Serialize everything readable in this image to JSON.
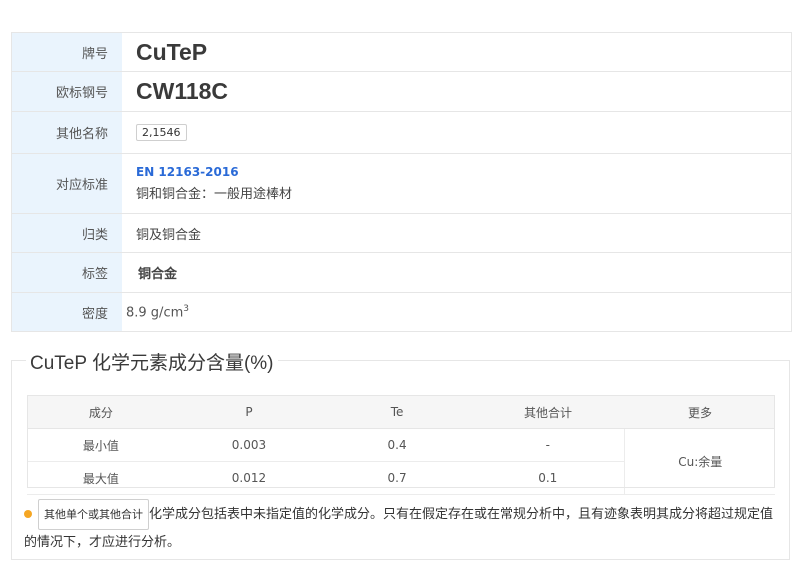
{
  "properties": [
    {
      "label": "牌号",
      "value": "CuTeP"
    },
    {
      "label": "欧标钢号",
      "value": "CW118C"
    },
    {
      "label": "其他名称",
      "value": "2,1546"
    },
    {
      "label": "对应标准",
      "code": "EN 12163-2016",
      "desc": "铜和铜合金：一般用途棒材"
    },
    {
      "label": "归类",
      "value": "铜及铜合金"
    },
    {
      "label": "标签",
      "value": "铜合金"
    },
    {
      "label": "密度",
      "value": "8.9 g/cm",
      "sup": "3"
    }
  ],
  "composition": {
    "title": "CuTeP 化学元素成分含量(%)",
    "headers": [
      "成分",
      "P",
      "Te",
      "其他合计",
      "更多"
    ],
    "rows": [
      {
        "name": "最小值",
        "P": "0.003",
        "Te": "0.4",
        "other": "-"
      },
      {
        "name": "最大值",
        "P": "0.012",
        "Te": "0.7",
        "other": "0.1"
      }
    ],
    "more": "Cu:余量"
  },
  "note": {
    "chip": "其他单个或其他合计",
    "text": "化学成分包括表中未指定值的化学成分。只有在假定存在或在常规分析中，且有迹象表明其成分将超过规定值的情况下，才应进行分析。"
  },
  "colors": {
    "label_bg": "#eaf4fd",
    "link": "#2a6ad7",
    "bullet": "#f5a623"
  }
}
